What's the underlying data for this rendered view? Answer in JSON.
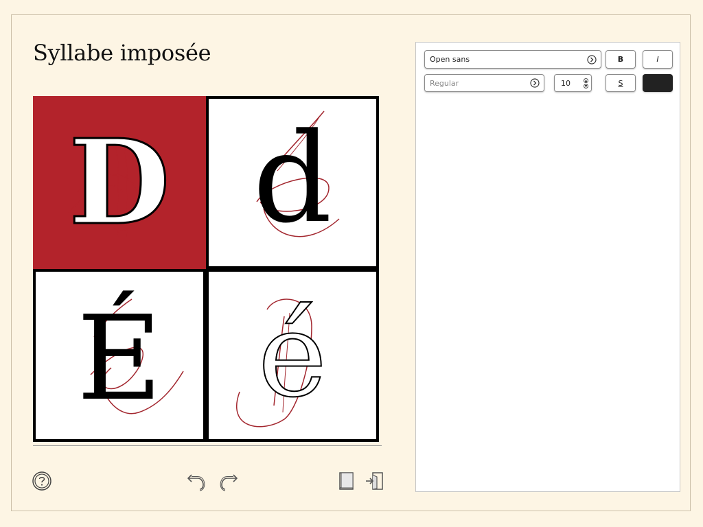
{
  "page": {
    "title": "Syllabe imposée"
  },
  "tiles": [
    {
      "glyph": "D",
      "style": "red-background-white-outlined"
    },
    {
      "glyph": "d",
      "style": "black-serif"
    },
    {
      "glyph": "É",
      "style": "black-serif"
    },
    {
      "glyph": "é",
      "style": "outlined-serif"
    }
  ],
  "colors": {
    "background": "#fdf5e4",
    "accent_red": "#b3232b",
    "stroke_red": "#a3272f",
    "color_swatch": "#222222"
  },
  "toolbar": {
    "help_icon": "help-icon",
    "undo_icon": "undo-icon",
    "redo_icon": "redo-icon",
    "book_icon": "book-icon",
    "exit_icon": "exit-icon"
  },
  "panel": {
    "font_family": "Open sans",
    "font_weight_placeholder": "Regular",
    "font_size": "10",
    "bold_label": "B",
    "italic_label": "I",
    "strike_label": "S"
  }
}
